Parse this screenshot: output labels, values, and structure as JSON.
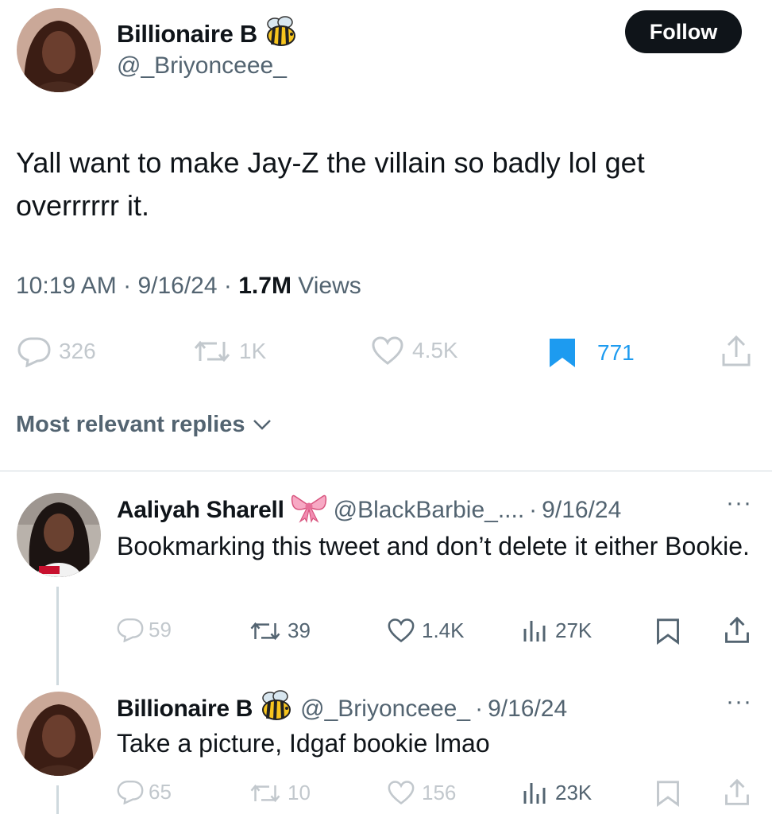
{
  "main_tweet": {
    "author_name": "Billionaire B",
    "author_emoji": "bee-emoji",
    "handle": "@_Briyonceee_",
    "follow_label": "Follow",
    "text": "Yall want to make Jay-Z the villain so badly lol get overrrrrr it.",
    "time": "10:19 AM",
    "date": "9/16/24",
    "views_count": "1.7M",
    "views_label": "Views",
    "separator": "·",
    "actions": {
      "replies": "326",
      "reposts": "1K",
      "likes": "4.5K",
      "bookmarks": "771"
    }
  },
  "replies_sort_label": "Most relevant replies",
  "replies": [
    {
      "author_name": "Aaliyah Sharell",
      "author_emoji": "ribbon-emoji",
      "handle": "@BlackBarbie_....",
      "date": "9/16/24",
      "text": "Bookmarking this tweet and don’t delete it either Bookie.",
      "actions": {
        "replies": "59",
        "reposts": "39",
        "likes": "1.4K",
        "views": "27K"
      }
    },
    {
      "author_name": "Billionaire B",
      "author_emoji": "bee-emoji",
      "handle": "@_Briyonceee_",
      "date": "9/16/24",
      "text": "Take a picture, Idgaf bookie lmao",
      "actions": {
        "replies": "65",
        "reposts": "10",
        "likes": "156",
        "views": "23K"
      }
    }
  ],
  "colors": {
    "text": "#0f1419",
    "secondary": "#536471",
    "accent": "#1d9bf0",
    "divider": "#cfd9de",
    "follow_bg": "#0f1419"
  }
}
